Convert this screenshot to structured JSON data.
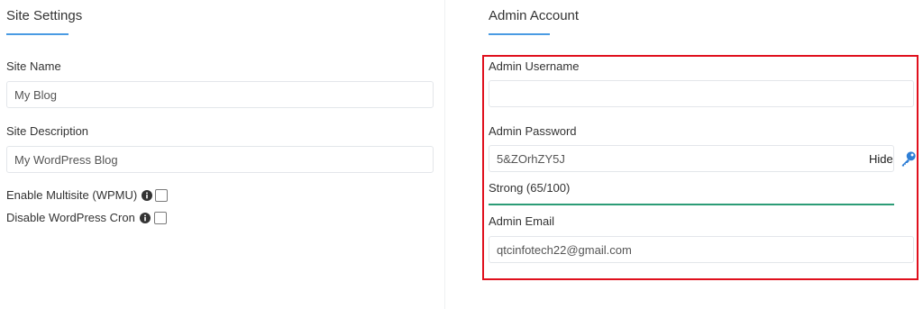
{
  "site_settings": {
    "title": "Site Settings",
    "site_name_label": "Site Name",
    "site_name_value": "My Blog",
    "site_description_label": "Site Description",
    "site_description_value": "My WordPress Blog",
    "multisite_label": "Enable Multisite (WPMU)",
    "multisite_checked": false,
    "disable_cron_label": "Disable WordPress Cron",
    "disable_cron_checked": false
  },
  "admin_account": {
    "title": "Admin Account",
    "username_label": "Admin Username",
    "username_value": "",
    "password_label": "Admin Password",
    "password_value": "5&ZOrhZY5J",
    "hide_label": "Hide",
    "strength_text": "Strong (65/100)",
    "strength_score": 65,
    "email_label": "Admin Email",
    "email_value": "qtcinfotech22@gmail.com"
  },
  "colors": {
    "accent": "#4a9be3",
    "highlight": "#e0101d",
    "strength": "#2c9c76",
    "key_icon": "#2f7fd6"
  }
}
